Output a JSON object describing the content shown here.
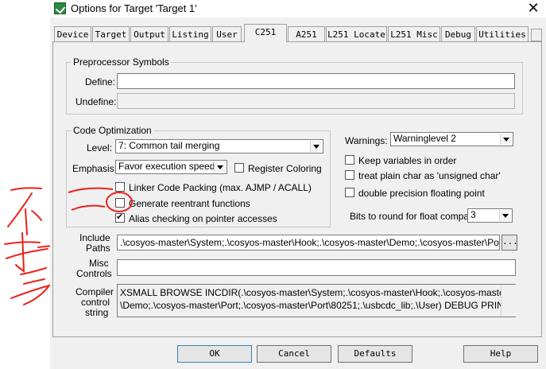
{
  "window": {
    "title": "Options for Target 'Target 1'",
    "close_glyph": "✕",
    "icon": "keil-app-icon"
  },
  "tabs": [
    "Device",
    "Target",
    "Output",
    "Listing",
    "User",
    "C251",
    "A251",
    "L251 Locate",
    "L251 Misc",
    "Debug",
    "Utilities"
  ],
  "active_tab": "C251",
  "preprocessor": {
    "title": "Preprocessor Symbols",
    "define_label": "Define:",
    "define_value": "",
    "undefine_label": "Undefine:",
    "undefine_value": ""
  },
  "code_opt": {
    "title": "Code Optimization",
    "level_label": "Level:",
    "level_value": "7: Common tail merging",
    "emphasis_label": "Emphasis:",
    "emphasis_value": "Favor execution speed",
    "register_coloring": {
      "label": "Register Coloring",
      "checked": false
    },
    "linker_packing": {
      "label": "Linker Code Packing (max. AJMP / ACALL)",
      "checked": false
    },
    "reentrant": {
      "label": "Generate reentrant functions",
      "checked": false
    },
    "alias": {
      "label": "Alias checking on pointer accesses",
      "checked": true
    }
  },
  "warnings": {
    "label": "Warnings:",
    "value": "Warninglevel 2"
  },
  "options": {
    "keep_vars": {
      "label": "Keep variables in order",
      "checked": false
    },
    "plain_char": {
      "label": "treat plain char as 'unsigned char'",
      "checked": false
    },
    "double_fp": {
      "label": "double precision floating point",
      "checked": false
    }
  },
  "bits_round": {
    "label": "Bits to round for float compare:",
    "value": "3"
  },
  "include": {
    "label_line1": "Include",
    "label_line2": "Paths",
    "value": ".\\cosyos-master\\System;.\\cosyos-master\\Hook;.\\cosyos-master\\Demo;.\\cosyos-master\\Port;.\\cosyos",
    "browse_label": "..."
  },
  "misc": {
    "label_line1": "Misc",
    "label_line2": "Controls",
    "value": ""
  },
  "compiler": {
    "label_line1": "Compiler",
    "label_line2": "control",
    "label_line3": "string",
    "line1": "XSMALL BROWSE INCDIR(.\\cosyos-master\\System;.\\cosyos-master\\Hook;.\\cosyos-master",
    "line2": "\\Demo;.\\cosyos-master\\Port;.\\cosyos-master\\Port\\80251;.\\usbcdc_lib;.\\User) DEBUG PRINT(."
  },
  "buttons": {
    "ok": "OK",
    "cancel": "Cancel",
    "defaults": "Defaults",
    "help": "Help"
  },
  "annotation": {
    "text": "不打勾",
    "color": "#e8231b"
  }
}
